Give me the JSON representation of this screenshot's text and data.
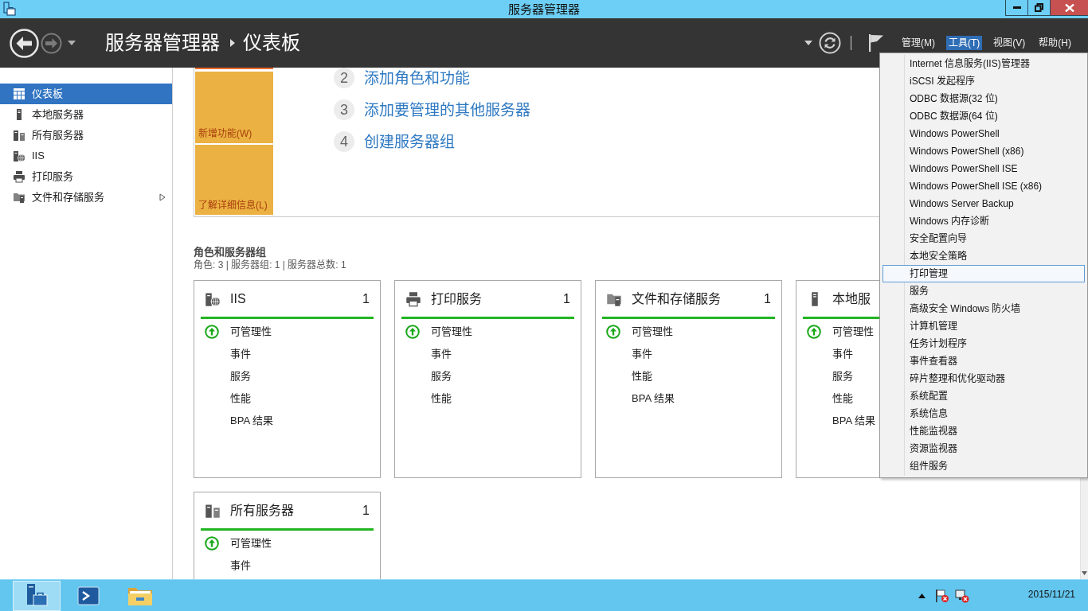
{
  "window": {
    "title": "服务器管理器"
  },
  "header": {
    "navigation": [
      {
        "kind": "back",
        "disabled": false
      },
      {
        "kind": "forward",
        "disabled": true
      }
    ],
    "breadcrumb": [
      "服务器管理器",
      "仪表板"
    ],
    "menus": [
      {
        "label": "管理(M)",
        "selected": false
      },
      {
        "label": "工具(T)",
        "selected": true
      },
      {
        "label": "视图(V)",
        "selected": false
      },
      {
        "label": "帮助(H)",
        "selected": false
      }
    ]
  },
  "sidebar": {
    "items": [
      {
        "label": "仪表板",
        "kind": "dashboard",
        "selected": true,
        "expandable": false
      },
      {
        "label": "本地服务器",
        "kind": "server",
        "selected": false,
        "expandable": false
      },
      {
        "label": "所有服务器",
        "kind": "servers",
        "selected": false,
        "expandable": false
      },
      {
        "label": "IIS",
        "kind": "iis",
        "selected": false,
        "expandable": false
      },
      {
        "label": "打印服务",
        "kind": "printer",
        "selected": false,
        "expandable": false
      },
      {
        "label": "文件和存储服务",
        "kind": "storage",
        "selected": false,
        "expandable": true
      }
    ]
  },
  "welcome": {
    "tiles": [
      "新增功能(W)",
      "了解详细信息(L)"
    ],
    "steps": [
      {
        "number": "2",
        "label": "添加角色和功能"
      },
      {
        "number": "3",
        "label": "添加要管理的其他服务器"
      },
      {
        "number": "4",
        "label": "创建服务器组"
      }
    ]
  },
  "roles": {
    "title": "角色和服务器组",
    "summary": "角色: 3 | 服务器组: 1 | 服务器总数: 1",
    "cards": [
      {
        "kind": "iis",
        "title": "IIS",
        "count": "1",
        "rows": [
          {
            "label": "可管理性",
            "ok": true
          },
          {
            "label": "事件",
            "ok": false
          },
          {
            "label": "服务",
            "ok": false
          },
          {
            "label": "性能",
            "ok": false
          },
          {
            "label": "BPA 结果",
            "ok": false
          }
        ]
      },
      {
        "kind": "printer",
        "title": "打印服务",
        "count": "1",
        "rows": [
          {
            "label": "可管理性",
            "ok": true
          },
          {
            "label": "事件",
            "ok": false
          },
          {
            "label": "服务",
            "ok": false
          },
          {
            "label": "性能",
            "ok": false
          }
        ]
      },
      {
        "kind": "storage",
        "title": "文件和存储服务",
        "count": "1",
        "rows": [
          {
            "label": "可管理性",
            "ok": true
          },
          {
            "label": "事件",
            "ok": false
          },
          {
            "label": "性能",
            "ok": false
          },
          {
            "label": "BPA 结果",
            "ok": false
          }
        ]
      },
      {
        "kind": "server",
        "title": "本地服",
        "rows": [
          {
            "label": "可管理性",
            "ok": true
          },
          {
            "label": "事件",
            "ok": false
          },
          {
            "label": "服务",
            "ok": false
          },
          {
            "label": "性能",
            "ok": false
          },
          {
            "label": "BPA 结果",
            "ok": false
          }
        ]
      },
      {
        "kind": "servers",
        "title": "所有服务器",
        "count": "1",
        "rows": [
          {
            "label": "可管理性",
            "ok": true
          },
          {
            "label": "事件",
            "ok": false
          }
        ]
      }
    ]
  },
  "tools_menu": {
    "items": [
      {
        "label": "Internet 信息服务(IIS)管理器",
        "selected": false
      },
      {
        "label": "iSCSI 发起程序",
        "selected": false
      },
      {
        "label": "ODBC 数据源(32 位)",
        "selected": false
      },
      {
        "label": "ODBC 数据源(64 位)",
        "selected": false
      },
      {
        "label": "Windows PowerShell",
        "selected": false
      },
      {
        "label": "Windows PowerShell (x86)",
        "selected": false
      },
      {
        "label": "Windows PowerShell ISE",
        "selected": false
      },
      {
        "label": "Windows PowerShell ISE (x86)",
        "selected": false
      },
      {
        "label": "Windows Server Backup",
        "selected": false
      },
      {
        "label": "Windows 内存诊断",
        "selected": false
      },
      {
        "label": "安全配置向导",
        "selected": false
      },
      {
        "label": "本地安全策略",
        "selected": false
      },
      {
        "label": "打印管理",
        "selected": true
      },
      {
        "label": "服务",
        "selected": false
      },
      {
        "label": "高级安全 Windows 防火墙",
        "selected": false
      },
      {
        "label": "计算机管理",
        "selected": false
      },
      {
        "label": "任务计划程序",
        "selected": false
      },
      {
        "label": "事件查看器",
        "selected": false
      },
      {
        "label": "碎片整理和优化驱动器",
        "selected": false
      },
      {
        "label": "系统配置",
        "selected": false
      },
      {
        "label": "系统信息",
        "selected": false
      },
      {
        "label": "性能监视器",
        "selected": false
      },
      {
        "label": "资源监视器",
        "selected": false
      },
      {
        "label": "组件服务",
        "selected": false
      }
    ]
  },
  "taskbar": {
    "apps": [
      {
        "kind": "server-manager",
        "selected": true
      },
      {
        "kind": "powershell",
        "selected": false
      },
      {
        "kind": "explorer",
        "selected": false
      }
    ],
    "date": "2015/11/21"
  }
}
